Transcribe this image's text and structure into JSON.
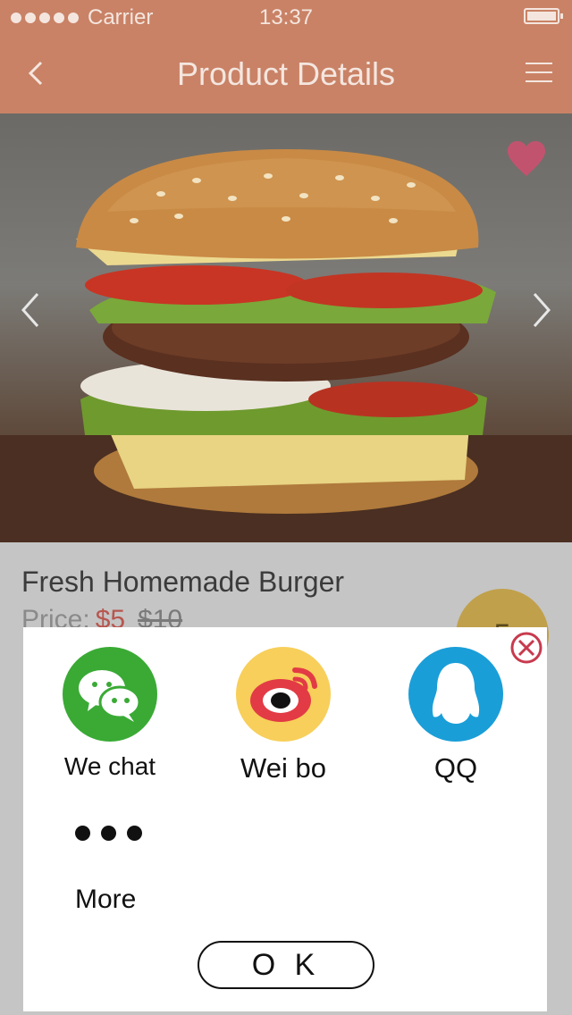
{
  "status_bar": {
    "carrier": "Carrier",
    "time": "13:37"
  },
  "nav": {
    "title": "Product Details",
    "back_icon": "chevron-left-icon",
    "menu_icon": "hamburger-menu-icon"
  },
  "hero": {
    "favorite_icon": "heart-icon",
    "prev_icon": "chevron-left-icon",
    "next_icon": "chevron-right-icon"
  },
  "product": {
    "name": "Fresh Homemade Burger",
    "price_label": "Price:",
    "price": "$5",
    "old_price": "$10",
    "badge_text": "5"
  },
  "share_sheet": {
    "options": [
      {
        "label": "We chat",
        "icon": "wechat-icon",
        "color": "#3aaa35"
      },
      {
        "label": "Wei bo",
        "icon": "weibo-icon",
        "color": "#f7cf5a"
      },
      {
        "label": "QQ",
        "icon": "qq-icon",
        "color": "#1a9ed8"
      }
    ],
    "more_label": "More",
    "ok_label": "O K",
    "close_icon": "close-circle-icon"
  },
  "colors": {
    "nav": "#c98266",
    "accent_red": "#b7564f",
    "heart": "#c2536e"
  }
}
